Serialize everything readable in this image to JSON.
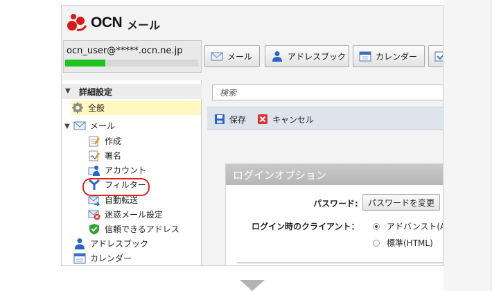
{
  "header": {
    "brand": "OCN",
    "product": "メール"
  },
  "account": {
    "email": "ocn_user@*****.ocn.ne.jp",
    "usage_fraction": 0.3
  },
  "top_nav": [
    {
      "label": "メール",
      "icon": "envelope-icon"
    },
    {
      "label": "アドレスブック",
      "icon": "person-icon"
    },
    {
      "label": "カレンダー",
      "icon": "calendar-icon"
    }
  ],
  "sidebar": {
    "title": "詳細設定",
    "items": [
      {
        "label": "全般",
        "icon": "gear-icon"
      },
      {
        "label": "メール",
        "icon": "envelope-icon"
      },
      {
        "label": "作成",
        "icon": "compose-icon"
      },
      {
        "label": "署名",
        "icon": "signature-icon"
      },
      {
        "label": "アカウント",
        "icon": "account-icon"
      },
      {
        "label": "フィルター",
        "icon": "filter-icon"
      },
      {
        "label": "自動転送",
        "icon": "forward-icon"
      },
      {
        "label": "迷惑メール設定",
        "icon": "spam-icon"
      },
      {
        "label": "信頼できるアドレス",
        "icon": "shield-check-icon"
      },
      {
        "label": "アドレスブック",
        "icon": "person-icon"
      },
      {
        "label": "カレンダー",
        "icon": "calendar-icon"
      }
    ]
  },
  "search": {
    "placeholder": "検索"
  },
  "toolbar": {
    "save_label": "保存",
    "cancel_label": "キャンセル"
  },
  "login_options": {
    "title": "ログインオプション",
    "password_label": "パスワード:",
    "password_button": "パスワードを変更",
    "client_label": "ログイン時のクライアント：",
    "options": [
      {
        "label": "アドバンスト(A",
        "selected": true
      },
      {
        "label": "標準(HTML)",
        "selected": false
      }
    ]
  },
  "colors": {
    "usage_fill": "#1fc41f",
    "highlight_circle": "#e32020",
    "selected_item": "#fff7c0"
  }
}
